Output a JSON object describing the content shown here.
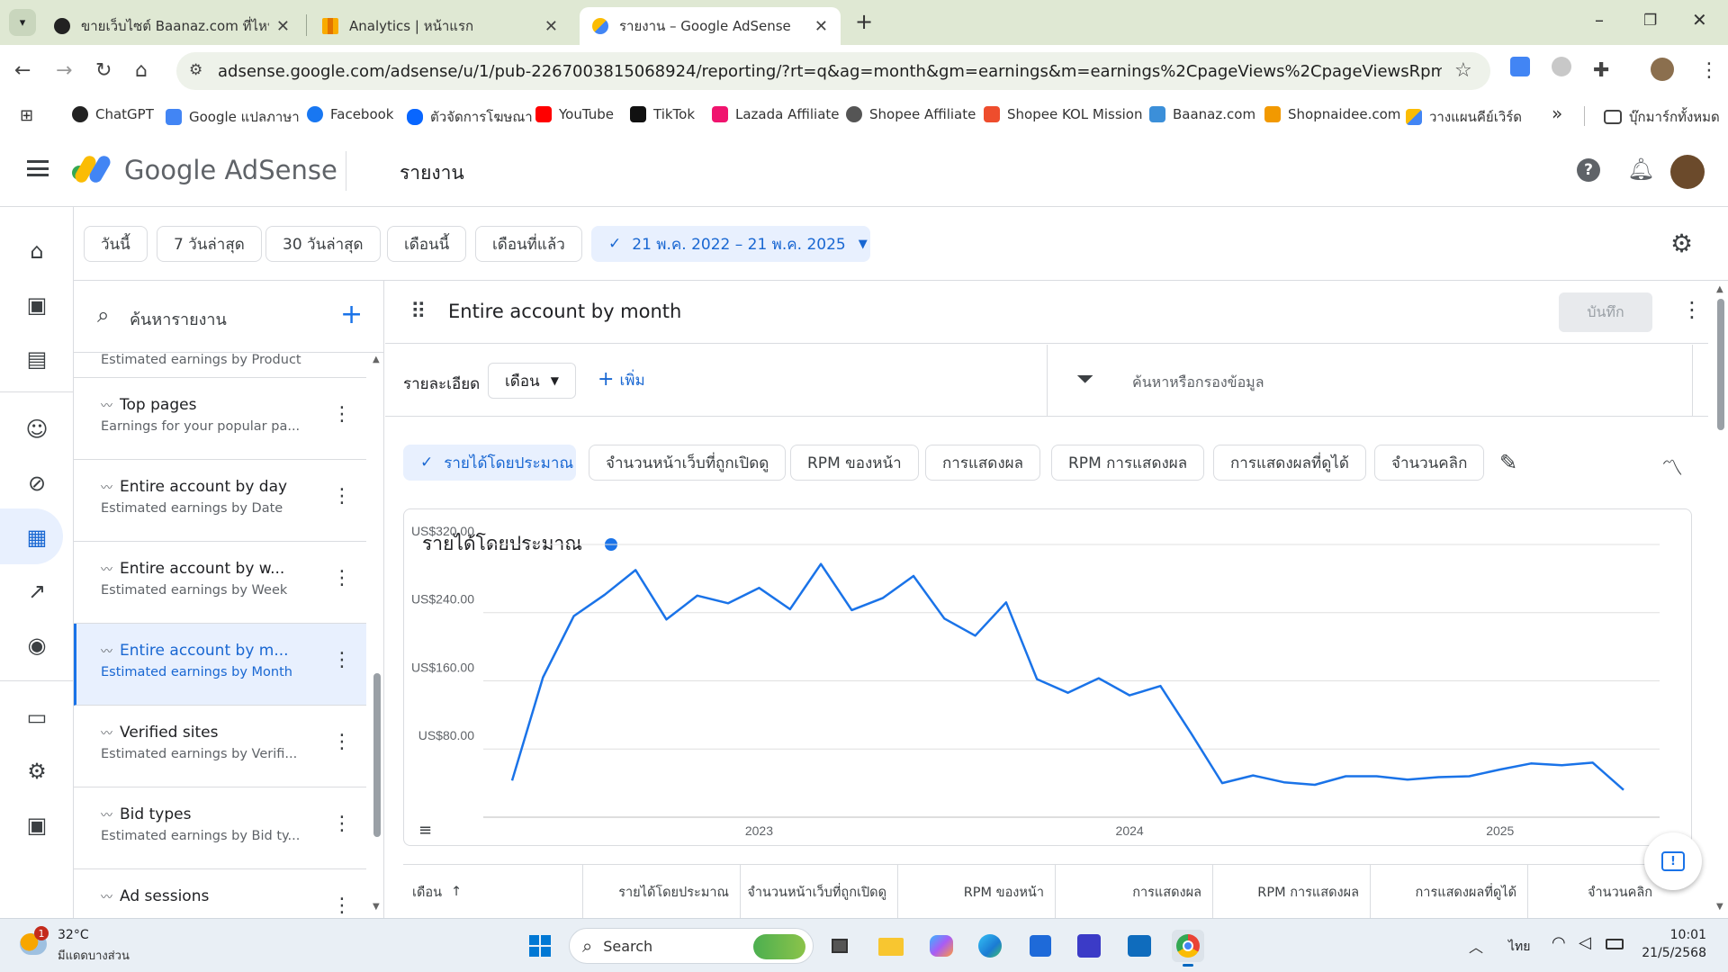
{
  "browser": {
    "tabs": [
      {
        "title": "ขายเว็บไซต์ Baanaz.com ที่ไหนดี",
        "close": "✕"
      },
      {
        "title": "Analytics | หน้าแรก",
        "close": "✕"
      },
      {
        "title": "รายงาน – Google AdSense",
        "close": "✕"
      }
    ],
    "new_tab": "+",
    "url": "adsense.google.com/adsense/u/1/pub-2267003815068924/reporting/?rt=q&ag=month&gm=earnings&m=earnings%2CpageViews%2CpageViewsRpm%2CmonetizableImpr...",
    "bookmarks": [
      "ChatGPT",
      "Google แปลภาษา",
      "Facebook",
      "ตัวจัดการโฆษณา",
      "YouTube",
      "TikTok",
      "Lazada Affiliate",
      "Shopee Affiliate",
      "Shopee KOL Mission",
      "Baanaz.com",
      "Shopnaidee.com",
      "วางแผนคีย์เวิร์ด"
    ],
    "bookmarks_overflow": "»",
    "all_bookmarks": "บุ๊กมาร์กทั้งหมด"
  },
  "app": {
    "brand": "Google AdSense",
    "page_title": "รายงาน"
  },
  "date_chips": [
    "วันนี้",
    "7 วันล่าสุด",
    "30 วันล่าสุด",
    "เดือนนี้",
    "เดือนที่แล้ว"
  ],
  "date_range": "21 พ.ค. 2022 – 21 พ.ค. 2025",
  "reports_panel": {
    "search_placeholder": "ค้นหารายงาน",
    "partial_item": "Estimated earnings by Product",
    "items": [
      {
        "title": "Top pages",
        "subtitle": "Earnings for your popular pa..."
      },
      {
        "title": "Entire account by day",
        "subtitle": "Estimated earnings by Date"
      },
      {
        "title": "Entire account by w...",
        "subtitle": "Estimated earnings by Week"
      },
      {
        "title": "Entire account by m...",
        "subtitle": "Estimated earnings by Month"
      },
      {
        "title": "Verified sites",
        "subtitle": "Estimated earnings by Verifi..."
      },
      {
        "title": "Bid types",
        "subtitle": "Estimated earnings by Bid ty..."
      },
      {
        "title": "Ad sessions",
        "subtitle": ""
      }
    ]
  },
  "report": {
    "title": "Entire account by month",
    "save_label": "บันทึก",
    "detail_label": "รายละเอียด",
    "dimension_value": "เดือน",
    "add_label": "เพิ่ม",
    "filter_placeholder": "ค้นหาหรือกรองข้อมูล",
    "metrics": [
      "รายได้โดยประมาณ",
      "จำนวนหน้าเว็บที่ถูกเปิดดู",
      "RPM ของหน้า",
      "การแสดงผล",
      "RPM การแสดงผล",
      "การแสดงผลที่ดูได้",
      "จำนวนคลิก"
    ]
  },
  "chart_data": {
    "type": "line",
    "title": "รายได้โดยประมาณ",
    "series_color": "#1a73e8",
    "y_ticks": [
      "US$80.00",
      "US$160.00",
      "US$240.00",
      "US$320.00"
    ],
    "ylim": [
      0,
      340
    ],
    "x_tick_labels": [
      "2023",
      "2024",
      "2025"
    ],
    "x": [
      "2022-05",
      "2022-06",
      "2022-07",
      "2022-08",
      "2022-09",
      "2022-10",
      "2022-11",
      "2022-12",
      "2023-01",
      "2023-02",
      "2023-03",
      "2023-04",
      "2023-05",
      "2023-06",
      "2023-07",
      "2023-08",
      "2023-09",
      "2023-10",
      "2023-11",
      "2023-12",
      "2024-01",
      "2024-02",
      "2024-03",
      "2024-04",
      "2024-05",
      "2024-06",
      "2024-07",
      "2024-08",
      "2024-09",
      "2024-10",
      "2024-11",
      "2024-12",
      "2025-01",
      "2025-02",
      "2025-03",
      "2025-04",
      "2025-05"
    ],
    "series": [
      {
        "values": [
          43,
          164,
          236,
          261,
          290,
          232,
          260,
          251,
          269,
          244,
          297,
          243,
          257,
          283,
          233,
          213,
          252,
          162,
          146,
          163,
          143,
          154,
          98,
          40,
          49,
          41,
          38,
          48,
          48,
          44,
          47,
          48,
          56,
          63,
          61,
          64,
          32
        ]
      }
    ]
  },
  "table": {
    "headers": [
      "เดือน",
      "รายได้โดยประมาณ",
      "จำนวนหน้าเว็บที่ถูกเปิดดู",
      "RPM ของหน้า",
      "การแสดงผล",
      "RPM การแสดงผล",
      "การแสดงผลที่ดูได้",
      "จำนวนคลิก"
    ],
    "sort_arrow": "↑"
  },
  "taskbar": {
    "weather_temp": "32°C",
    "weather_desc": "มีแดดบางส่วน",
    "weather_badge": "1",
    "search_label": "Search",
    "language": "ไทย",
    "time": "10:01",
    "date": "21/5/2568"
  }
}
